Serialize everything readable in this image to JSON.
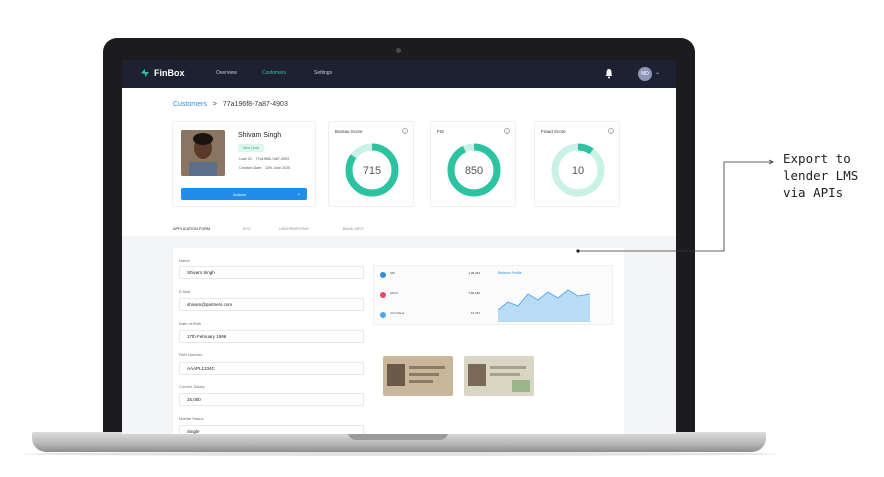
{
  "app": {
    "logo_text": "FinBox",
    "nav": {
      "overview": "Overview",
      "customers": "Customers",
      "settings": "Settings"
    },
    "user_initials": "MD"
  },
  "breadcrumb": {
    "root": "Customers",
    "separator": ">",
    "current": "77a196f8-7a87-4903"
  },
  "profile": {
    "name": "Shivam Singh",
    "badge": "New Lead",
    "loan_id_label": "Loan ID:",
    "loan_id": "77a196f8-7a87-4903",
    "creation_label": "Creation Date:",
    "creation_date": "12th June 2020",
    "actions_label": "Actions"
  },
  "scores": [
    {
      "title": "Bureau Score",
      "value": "715",
      "fraction": 0.85
    },
    {
      "title": "FIS",
      "value": "850",
      "fraction": 0.93
    },
    {
      "title": "Fraud Score",
      "value": "10",
      "fraction": 0.1
    }
  ],
  "tabs": [
    "APPLICATION FORM",
    "KYC",
    "UNDERWRITING",
    "BANK INFO"
  ],
  "form": {
    "name_label": "Name",
    "name_value": "Shivam Singh",
    "email_label": "E-Mail",
    "email_value": "shivam@partners.com",
    "dob_label": "Date of Birth",
    "dob_value": "17th February 1996",
    "pan_label": "PAN Number",
    "pan_value": "AAAPL1234C",
    "salary_label": "Current Salary",
    "salary_value": "25,000",
    "marital_label": "Marital Status",
    "marital_value": "Single"
  },
  "mini_panel": {
    "rows": [
      {
        "label": "SBI",
        "value": "1,09,264"
      },
      {
        "label": "HDFC",
        "value": "1,66,180"
      },
      {
        "label": "UCO Bank",
        "value": "13,767"
      }
    ],
    "chart_title": "Balance Profile"
  },
  "colors": {
    "accent": "#2cc3a1",
    "ring_track": "#c9f2e6",
    "primary": "#1f8de9",
    "nav_bg": "#1e2132"
  },
  "annotation": {
    "line1": "Export to",
    "line2": "lender LMS",
    "line3": "via APIs"
  }
}
